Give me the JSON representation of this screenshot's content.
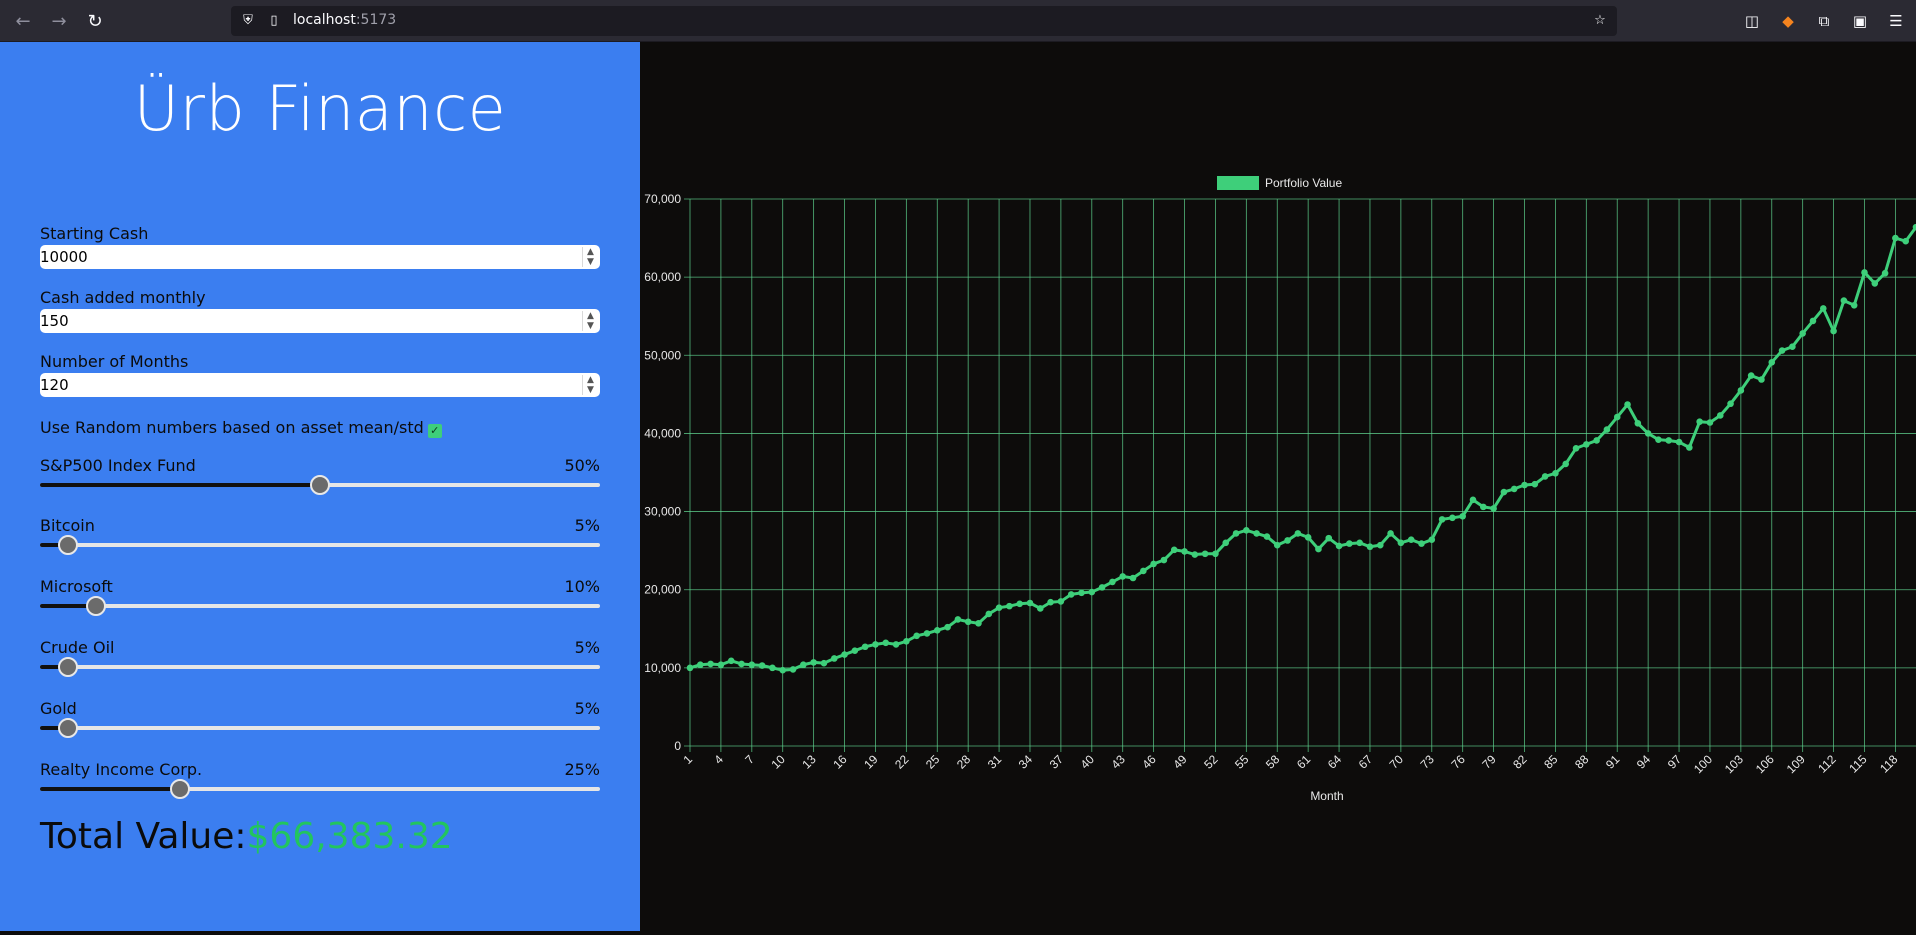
{
  "browser": {
    "url_host": "localhost",
    "url_port": ":5173"
  },
  "app": {
    "title": "Ürb Finance"
  },
  "inputs": {
    "starting_cash_label": "Starting Cash",
    "starting_cash_value": "10000",
    "monthly_label": "Cash added monthly",
    "monthly_value": "150",
    "months_label": "Number of Months",
    "months_value": "120",
    "random_label": "Use Random numbers based on asset mean/std",
    "random_checked": true
  },
  "sliders": [
    {
      "name": "S&P500 Index Fund",
      "pct_label": "50%",
      "value": 0.5
    },
    {
      "name": "Bitcoin",
      "pct_label": "5%",
      "value": 0.05
    },
    {
      "name": "Microsoft",
      "pct_label": "10%",
      "value": 0.1
    },
    {
      "name": "Crude Oil",
      "pct_label": "5%",
      "value": 0.05
    },
    {
      "name": "Gold",
      "pct_label": "5%",
      "value": 0.05
    },
    {
      "name": "Realty Income Corp.",
      "pct_label": "25%",
      "value": 0.25
    }
  ],
  "total": {
    "label": "Total Value:",
    "value": "$66,383.32"
  },
  "colors": {
    "panel": "#3b7ef0",
    "chart_bg": "#0d0c0b",
    "line": "#3ecf7a",
    "grid": "#5fd48f"
  },
  "chart_data": {
    "type": "line",
    "legend": "Portfolio Value",
    "xlabel": "Month",
    "ylim": [
      0,
      70000
    ],
    "yticks": [
      "0",
      "10,000",
      "20,000",
      "30,000",
      "40,000",
      "50,000",
      "60,000",
      "70,000"
    ],
    "xticks": [
      "1",
      "4",
      "7",
      "10",
      "13",
      "16",
      "19",
      "22",
      "25",
      "28",
      "31",
      "34",
      "37",
      "40",
      "43",
      "46",
      "49",
      "52",
      "55",
      "58",
      "61",
      "64",
      "67",
      "70",
      "73",
      "76",
      "79",
      "82",
      "85",
      "88",
      "91",
      "94",
      "97",
      "100",
      "103",
      "106",
      "109",
      "112",
      "115",
      "118"
    ],
    "series": [
      {
        "name": "Portfolio Value",
        "values": [
          10000,
          10400,
          10500,
          10400,
          10900,
          10500,
          10400,
          10300,
          10000,
          9700,
          9800,
          10400,
          10700,
          10600,
          11200,
          11700,
          12200,
          12700,
          13000,
          13200,
          13000,
          13400,
          14100,
          14400,
          14800,
          15200,
          16200,
          15900,
          15700,
          16900,
          17700,
          17900,
          18200,
          18300,
          17600,
          18400,
          18500,
          19400,
          19600,
          19700,
          20300,
          21000,
          21700,
          21500,
          22400,
          23300,
          23800,
          25100,
          24900,
          24500,
          24600,
          24600,
          26000,
          27200,
          27600,
          27200,
          26800,
          25700,
          26300,
          27200,
          26700,
          25200,
          26600,
          25600,
          25900,
          26000,
          25500,
          25700,
          27200,
          26000,
          26400,
          25900,
          26400,
          29000,
          29200,
          29400,
          31500,
          30600,
          30400,
          32500,
          32900,
          33400,
          33500,
          34500,
          34900,
          36100,
          38100,
          38600,
          39100,
          40500,
          42100,
          43700,
          41300,
          40000,
          39200,
          39100,
          38900,
          38200,
          41500,
          41400,
          42300,
          43800,
          45500,
          47400,
          46900,
          49100,
          50600,
          51100,
          52800,
          54400,
          56000,
          53100,
          57000,
          56400,
          60600,
          59200,
          60500,
          65000,
          64600,
          66400
        ]
      }
    ]
  }
}
